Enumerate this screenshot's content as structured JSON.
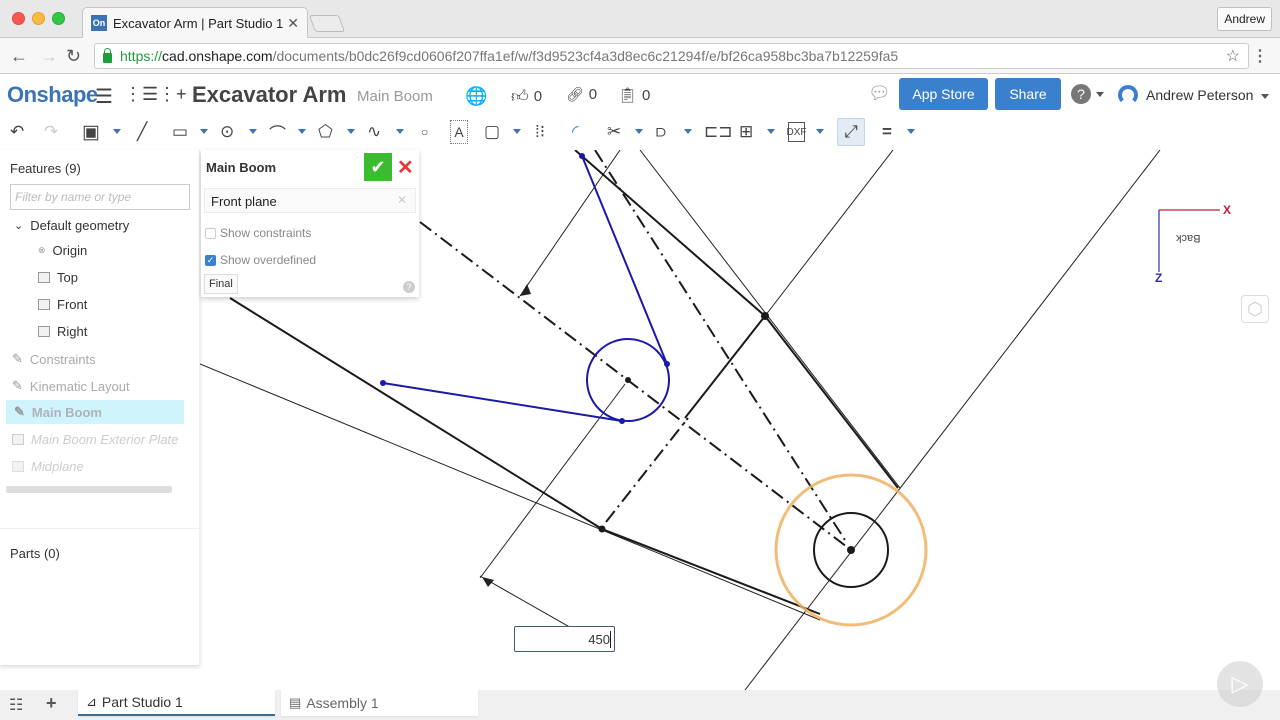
{
  "browser": {
    "tab_title": "Excavator Arm | Part Studio 1",
    "favicon_text": "On",
    "profile": "Andrew",
    "url": {
      "scheme": "https://",
      "host": "cad.onshape.com",
      "path": "/documents/b0dc26f9cd0606f207ffa1ef/w/f3d9523cf4a3d8ec6c21294f/e/bf26ca958bc3ba7b12259fa5"
    }
  },
  "header": {
    "logo": "Onshape",
    "document_title": "Excavator Arm",
    "subtitle": "Main Boom",
    "likes": "0",
    "links": "0",
    "copies": "0",
    "app_store_label": "App Store",
    "share_label": "Share",
    "user_name": "Andrew Peterson"
  },
  "toolbar": {
    "tools": [
      "undo",
      "redo",
      "new-sketch",
      "line",
      "rectangle",
      "circle",
      "arc",
      "polygon",
      "spline",
      "point",
      "text",
      "use",
      "midpoint-line",
      "fillet",
      "trim",
      "offset",
      "constraints",
      "pattern",
      "dxf-import",
      "dimension",
      "equal"
    ],
    "active_tool": "dimension"
  },
  "features": {
    "title": "Features (9)",
    "filter_placeholder": "Filter by name or type",
    "default_geometry": "Default geometry",
    "items": [
      {
        "label": "Origin"
      },
      {
        "label": "Top"
      },
      {
        "label": "Front"
      },
      {
        "label": "Right"
      },
      {
        "label": "Constraints"
      },
      {
        "label": "Kinematic Layout"
      },
      {
        "label": "Main Boom"
      },
      {
        "label": "Main Boom Exterior Plate"
      },
      {
        "label": "Midplane"
      }
    ],
    "parts_title": "Parts (0)"
  },
  "sketch_dialog": {
    "title": "Main Boom",
    "plane": "Front plane",
    "show_constraints_label": "Show constraints",
    "show_constraints_checked": false,
    "show_overdefined_label": "Show overdefined",
    "show_overdefined_checked": true,
    "final_label": "Final",
    "help": "?"
  },
  "canvas": {
    "dimension_value": "450",
    "triad": {
      "x_label": "X",
      "z_label": "Z",
      "view_label": "Back"
    },
    "colors": {
      "sketch_blue": "#1a1aa8",
      "geometry": "#1a1a1a",
      "highlight": "#f0b060"
    }
  },
  "bottom": {
    "tabs": [
      {
        "label": "Part Studio 1",
        "active": true
      },
      {
        "label": "Assembly 1",
        "active": false
      }
    ]
  }
}
